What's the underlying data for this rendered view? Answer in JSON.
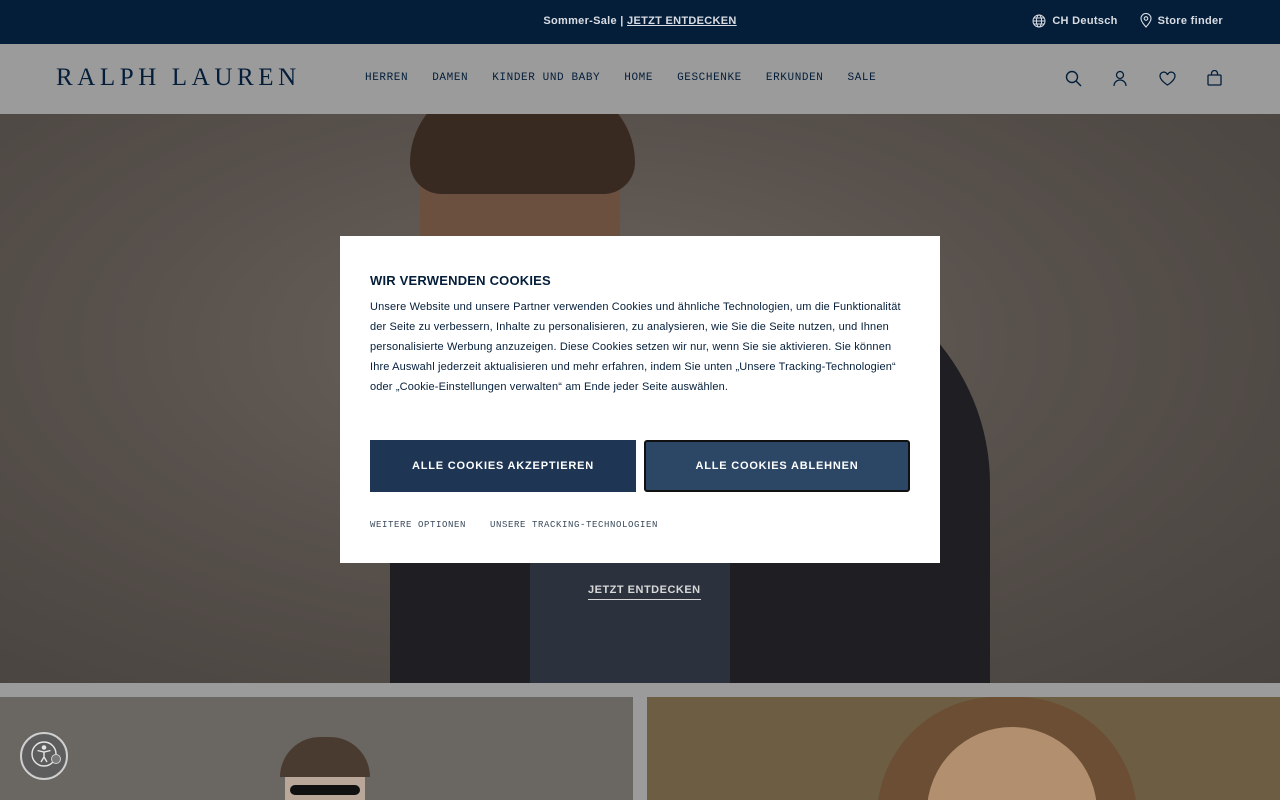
{
  "promo": {
    "text": "Sommer-Sale | ",
    "link": "JETZT ENTDECKEN",
    "region": "CH Deutsch",
    "store_finder": "Store finder",
    "region_icon": "globe-icon",
    "store_icon": "location-pin-icon"
  },
  "header": {
    "logo": "RALPH LAUREN",
    "nav": [
      "HERREN",
      "DAMEN",
      "KINDER UND BABY",
      "HOME",
      "GESCHENKE",
      "ERKUNDEN",
      "SALE"
    ],
    "icons": [
      "search-icon",
      "account-icon",
      "wishlist-icon",
      "bag-icon"
    ]
  },
  "hero": {
    "cta": "JETZT ENTDECKEN"
  },
  "cookie_modal": {
    "title": "WIR VERWENDEN COOKIES",
    "body": "Unsere Website und unsere Partner verwenden Cookies und ähnliche Technologien, um die Funktionalität der Seite zu verbessern, Inhalte zu personalisieren, zu analysieren, wie Sie die Seite nutzen, und Ihnen personalisierte Werbung anzuzeigen. Diese Cookies setzen wir nur, wenn Sie sie aktivieren. Sie können Ihre Auswahl jederzeit aktualisieren und mehr erfahren, indem Sie unten „Unsere Tracking-Technologien“ oder „Cookie-Einstellungen verwalten“ am Ende jeder Seite auswählen.",
    "accept_label": "ALLE COOKIES AKZEPTIEREN",
    "reject_label": "ALLE COOKIES ABLEHNEN",
    "more_options": "WEITERE OPTIONEN",
    "tracking_tech": "UNSERE TRACKING-TECHNOLOGIEN"
  },
  "accessibility": {
    "icon": "accessibility-icon"
  },
  "colors": {
    "navy": "#041e3a",
    "accept_button": "#1f3554",
    "reject_button": "#2c4666"
  }
}
